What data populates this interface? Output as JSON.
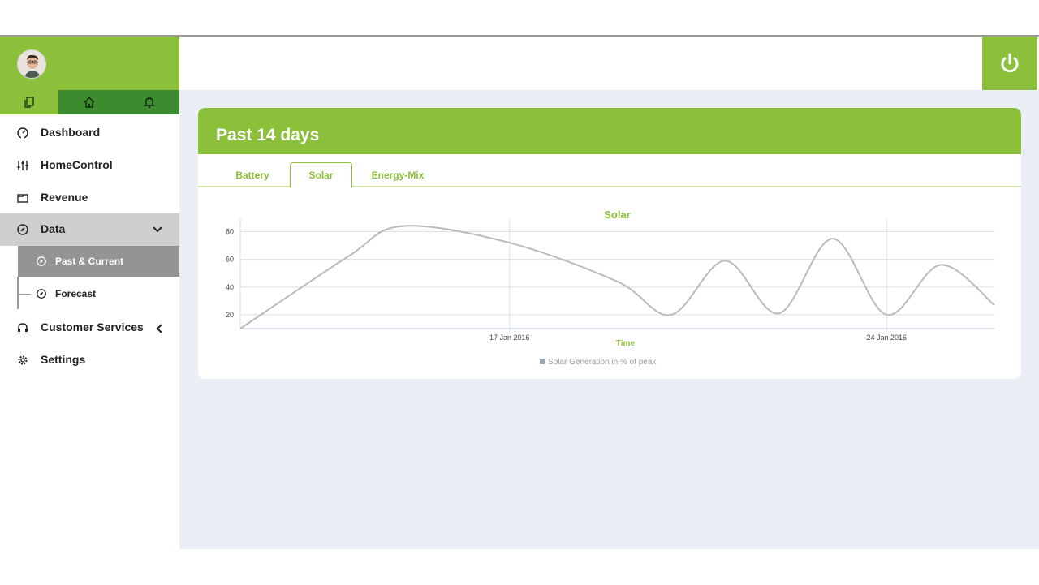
{
  "sidebar": {
    "nav": [
      {
        "label": "Dashboard",
        "icon": "gauge-icon"
      },
      {
        "label": "HomeControl",
        "icon": "sliders-icon"
      },
      {
        "label": "Revenue",
        "icon": "wallet-icon"
      },
      {
        "label": "Data",
        "icon": "compass-icon"
      },
      {
        "label": "Customer Services",
        "icon": "headset-icon"
      },
      {
        "label": "Settings",
        "icon": "gear-icon"
      }
    ],
    "sub_items": [
      {
        "label": "Past & Current",
        "icon": "compass-icon"
      },
      {
        "label": "Forecast",
        "icon": "compass-icon"
      }
    ]
  },
  "card": {
    "title": "Past 14 days",
    "tabs": [
      "Battery",
      "Solar",
      "Energy-Mix"
    ],
    "active_tab": "Solar"
  },
  "colors": {
    "accent": "#8dc03a",
    "accent_dark": "#3d8b2f",
    "series_line": "#bbbbbb",
    "grid": "#d6e0ee",
    "background": "#e9eff5"
  },
  "chart_data": {
    "type": "line",
    "title": "Solar",
    "xlabel": "Time",
    "ylabel": "",
    "x_tick_labels": [
      "17 Jan 2016",
      "24 Jan 2016"
    ],
    "y_ticks": [
      20,
      40,
      60,
      80
    ],
    "ylim": [
      10,
      85
    ],
    "grid": true,
    "legend_position": "bottom",
    "series": [
      {
        "name": "Solar Generation in % of peak",
        "x": [
          "2016-01-12",
          "2016-01-14",
          "2016-01-15",
          "2016-01-17",
          "2016-01-19",
          "2016-01-20",
          "2016-01-21",
          "2016-01-22",
          "2016-01-23",
          "2016-01-24",
          "2016-01-25",
          "2016-01-26"
        ],
        "values": [
          10,
          62,
          84,
          72,
          44,
          20,
          59,
          21,
          75,
          20,
          56,
          27
        ]
      }
    ]
  }
}
